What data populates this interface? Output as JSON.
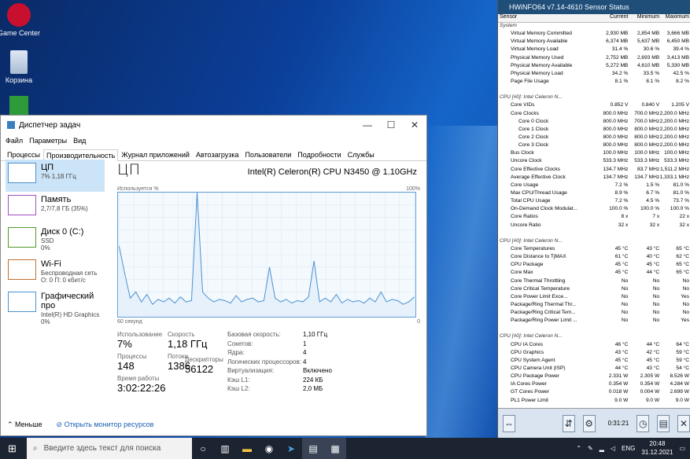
{
  "desktop": {
    "icons": [
      {
        "label": "Game Center"
      },
      {
        "label": "Корзина"
      },
      {
        "label": ""
      }
    ]
  },
  "tm": {
    "title": "Диспетчер задач",
    "menu": [
      "Файл",
      "Параметры",
      "Вид"
    ],
    "tabs": [
      "Процессы",
      "Производительность",
      "Журнал приложений",
      "Автозагрузка",
      "Пользователи",
      "Подробности",
      "Службы"
    ],
    "side": [
      {
        "name": "ЦП",
        "l1": "7% 1,18 ГГц",
        "l2": ""
      },
      {
        "name": "Память",
        "l1": "2,7/7,8 ГБ (35%)",
        "l2": ""
      },
      {
        "name": "Диск 0 (C:)",
        "l1": "SSD",
        "l2": "0%"
      },
      {
        "name": "Wi-Fi",
        "l1": "Беспроводная сеть",
        "l2": "О: 0 П: 0 кбит/с"
      },
      {
        "name": "Графический про",
        "l1": "Intel(R) HD Graphics",
        "l2": "0%"
      }
    ],
    "heading": "ЦП",
    "cpu": "Intel(R) Celeron(R) CPU N3450 @ 1.10GHz",
    "graph_top_left": "Используется %",
    "graph_top_right": "100%",
    "graph_bot_left": "60 секунд",
    "graph_bot_right": "0",
    "usage": [
      57,
      35,
      15,
      20,
      12,
      18,
      10,
      14,
      12,
      15,
      11,
      16,
      12,
      13,
      100,
      20,
      15,
      12,
      14,
      13,
      11,
      17,
      12,
      14,
      15,
      12,
      13,
      40,
      15,
      12,
      14,
      11,
      13,
      12,
      16,
      45,
      12,
      15,
      12,
      18,
      11,
      14,
      12,
      13,
      11,
      15,
      12,
      20,
      12,
      14,
      13,
      10,
      12,
      16
    ],
    "stats": {
      "usage_l": "Использование",
      "usage_v": "7%",
      "speed_l": "Скорость",
      "speed_v": "1,18 ГГц",
      "proc_l": "Процессы",
      "proc_v": "148",
      "thr_l": "Потоки",
      "thr_v": "1386",
      "desc_l": "Дескрипторы",
      "desc_v": "56122",
      "up_l": "Время работы",
      "up_v": "3:02:22:26"
    },
    "kv": [
      [
        "Базовая скорость:",
        "1,10 ГГц"
      ],
      [
        "Сокетов:",
        "1"
      ],
      [
        "Ядра:",
        "4"
      ],
      [
        "Логических процессоров:",
        "4"
      ],
      [
        "Виртуализация:",
        "Включено"
      ],
      [
        "Кэш L1:",
        "224 КБ"
      ],
      [
        "Кэш L2:",
        "2,0 МБ"
      ]
    ],
    "less": "Меньше",
    "monitor": "Открыть монитор ресурсов"
  },
  "hw": {
    "title": "HWiNFO64 v7.14-4610 Sensor Status",
    "cols": [
      "Sensor",
      "Current",
      "Minimum",
      "Maximum"
    ],
    "rows": [
      [
        "g",
        "System",
        "",
        "",
        ""
      ],
      [
        "Virtual Memory Committed",
        "2,930 MB",
        "2,854 MB",
        "3,666 MB"
      ],
      [
        "Virtual Memory Available",
        "6,374 MB",
        "5,637 MB",
        "6,450 MB"
      ],
      [
        "Virtual Memory Load",
        "31.4 %",
        "30.6 %",
        "39.4 %"
      ],
      [
        "Physical Memory Used",
        "2,752 MB",
        "2,693 MB",
        "3,413 MB"
      ],
      [
        "Physical Memory Available",
        "5,272 MB",
        "4,610 MB",
        "5,330 MB"
      ],
      [
        "Physical Memory Load",
        "34.2 %",
        "33.5 %",
        "42.5 %"
      ],
      [
        "Page File Usage",
        "8.1 %",
        "8.1 %",
        "8.2 %"
      ],
      [
        "b"
      ],
      [
        "g",
        "CPU [#0]: Intel Celeron N...",
        "",
        "",
        ""
      ],
      [
        "Core VIDs",
        "0.852 V",
        "0.840 V",
        "1.205 V"
      ],
      [
        "Core Clocks",
        "800.0 MHz",
        "700.0 MHz",
        "2,200.0 MHz"
      ],
      [
        "  Core 0 Clock",
        "800.0 MHz",
        "700.0 MHz",
        "2,200.0 MHz"
      ],
      [
        "  Core 1 Clock",
        "800.0 MHz",
        "800.0 MHz",
        "2,200.0 MHz"
      ],
      [
        "  Core 2 Clock",
        "800.0 MHz",
        "800.0 MHz",
        "2,200.0 MHz"
      ],
      [
        "  Core 3 Clock",
        "800.0 MHz",
        "800.0 MHz",
        "2,200.0 MHz"
      ],
      [
        "Bus Clock",
        "100.0 MHz",
        "100.0 MHz",
        "100.0 MHz"
      ],
      [
        "Uncore Clock",
        "533.3 MHz",
        "533.3 MHz",
        "533.3 MHz"
      ],
      [
        "Core Effective Clocks",
        "134.7 MHz",
        "83.7 MHz",
        "1,511.2 MHz"
      ],
      [
        "Average Effective Clock",
        "134.7 MHz",
        "134.7 MHz",
        "1,333.1 MHz"
      ],
      [
        "Core Usage",
        "7.2 %",
        "1.5 %",
        "81.0 %"
      ],
      [
        "Max CPU/Thread Usage",
        "8.9 %",
        "6.7 %",
        "81.0 %"
      ],
      [
        "Total CPU Usage",
        "7.2 %",
        "4.5 %",
        "73.7 %"
      ],
      [
        "On-Demand Clock Modulat...",
        "100.0 %",
        "100.0 %",
        "100.0 %"
      ],
      [
        "Core Ratios",
        "8 x",
        "7 x",
        "22 x"
      ],
      [
        "Uncore Ratio",
        "32 x",
        "32 x",
        "32 x"
      ],
      [
        "b"
      ],
      [
        "g",
        "CPU [#0]: Intel Celeron N...",
        "",
        "",
        ""
      ],
      [
        "Core Temperatures",
        "45 °C",
        "43 °C",
        "65 °C"
      ],
      [
        "Core Distance to TjMAX",
        "61 °C",
        "40 °C",
        "62 °C"
      ],
      [
        "CPU Package",
        "45 °C",
        "45 °C",
        "65 °C"
      ],
      [
        "Core Max",
        "45 °C",
        "44 °C",
        "65 °C"
      ],
      [
        "Core Thermal Throttling",
        "No",
        "No",
        "No"
      ],
      [
        "Core Critical Temperature",
        "No",
        "No",
        "No"
      ],
      [
        "Core Power Limit Exce...",
        "No",
        "No",
        "Yes"
      ],
      [
        "Package/Ring Thermal Thr...",
        "No",
        "No",
        "No"
      ],
      [
        "Package/Ring Critical Tem...",
        "No",
        "No",
        "No"
      ],
      [
        "Package/Ring Power Limit ...",
        "No",
        "No",
        "Yes"
      ],
      [
        "b"
      ],
      [
        "g",
        "CPU [#0]: Intel Celeron N...",
        "",
        "",
        ""
      ],
      [
        "CPU IA Cores",
        "46 °C",
        "44 °C",
        "64 °C"
      ],
      [
        "CPU Graphics",
        "43 °C",
        "42 °C",
        "59 °C"
      ],
      [
        "CPU System Agent",
        "45 °C",
        "45 °C",
        "59 °C"
      ],
      [
        "CPU Camera Unit (ISP)",
        "44 °C",
        "43 °C",
        "54 °C"
      ],
      [
        "CPU Package Power",
        "2.331 W",
        "2.305 W",
        "8.526 W"
      ],
      [
        "IA Cores Power",
        "0.354 W",
        "0.354 W",
        "4.284 W"
      ],
      [
        "GT Cores Power",
        "0.018 W",
        "0.004 W",
        "2.699 W"
      ],
      [
        "PL1 Power Limit",
        "9.0 W",
        "9.0 W",
        "9.0 W"
      ]
    ],
    "timer": "0:31:21"
  },
  "taskbar": {
    "search": "Введите здесь текст для поиска",
    "lang": "ENG",
    "time": "20:48",
    "date": "31.12.2021"
  }
}
